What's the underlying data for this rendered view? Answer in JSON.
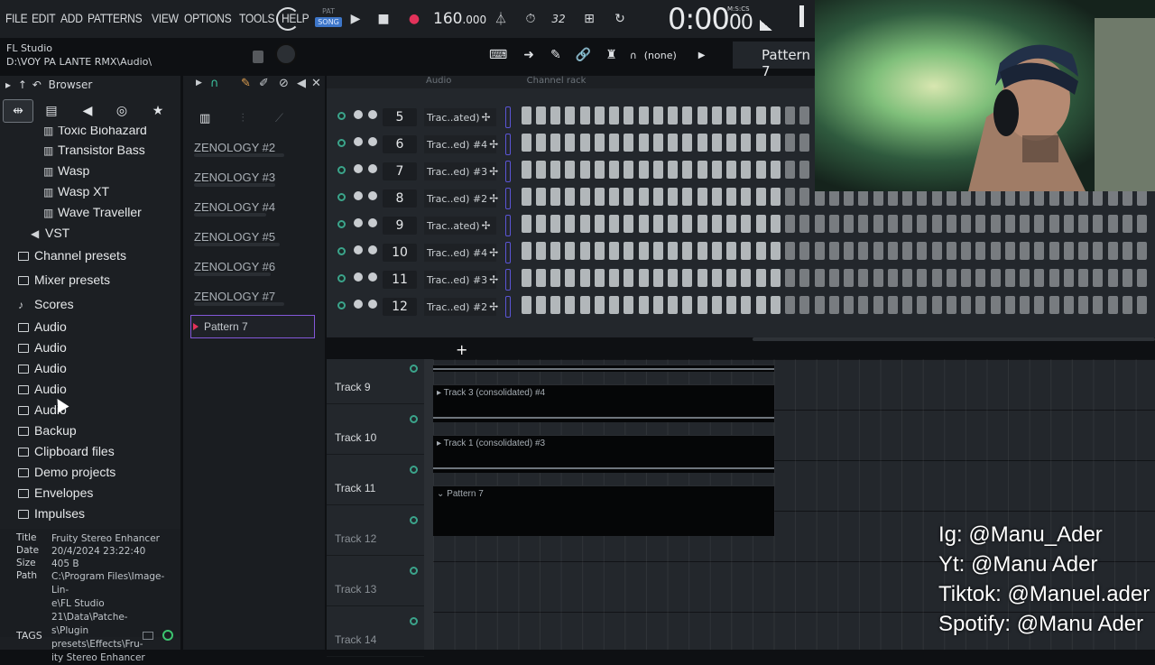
{
  "menu": [
    "FILE",
    "EDIT",
    "ADD",
    "PATTERNS",
    "VIEW",
    "OPTIONS",
    "TOOLS",
    "HELP"
  ],
  "app": {
    "name": "FL Studio",
    "project_path": "D:\\VOY PA LANTE RMX\\Audio\\"
  },
  "transport": {
    "pat_label": "PAT",
    "song_label": "SONG",
    "tempo": "160",
    "tempo_frac": ".000",
    "time_main": "0:00",
    "time_small": "00",
    "time_unit": "M:S:CS",
    "cpu_label": "32"
  },
  "toolbar2": {
    "midi_none": "(none)",
    "pattern": "Pattern 7"
  },
  "browser": {
    "title": "Browser",
    "items": [
      {
        "label": "Toxic Biohazard",
        "icon": "piano-icon"
      },
      {
        "label": "Transistor Bass",
        "icon": "piano-icon"
      },
      {
        "label": "Wasp",
        "icon": "piano-icon"
      },
      {
        "label": "Wasp XT",
        "icon": "piano-icon"
      },
      {
        "label": "Wave Traveller",
        "icon": "piano-icon"
      },
      {
        "label": "VST",
        "icon": "speaker-icon"
      },
      {
        "label": "Channel presets",
        "icon": "folder-icon"
      },
      {
        "label": "Mixer presets",
        "icon": "folder-icon"
      },
      {
        "label": "Scores",
        "icon": "note-icon"
      },
      {
        "label": "Audio",
        "icon": "folder-icon"
      },
      {
        "label": "Audio",
        "icon": "folder-icon"
      },
      {
        "label": "Audio",
        "icon": "folder-icon"
      },
      {
        "label": "Audio",
        "icon": "folder-icon"
      },
      {
        "label": "Audio",
        "icon": "folder-icon"
      },
      {
        "label": "Backup",
        "icon": "folder-icon"
      },
      {
        "label": "Clipboard files",
        "icon": "folder-icon"
      },
      {
        "label": "Demo projects",
        "icon": "folder-icon"
      },
      {
        "label": "Envelopes",
        "icon": "folder-icon"
      },
      {
        "label": "Impulses",
        "icon": "folder-icon"
      }
    ],
    "file_info": {
      "title_label": "Title",
      "title": "Fruity Stereo Enhancer",
      "date_label": "Date",
      "date": "20/4/2024 23:22:40",
      "size_label": "Size",
      "size": "405 B",
      "path_label": "Path",
      "path_lines": [
        "C:\\Program Files\\Image-Lin-",
        "e\\FL Studio 21\\Data\\Patche-",
        "s\\Plugin presets\\Effects\\Fru-",
        "ity Stereo Enhancer"
      ]
    },
    "tags_label": "TAGS"
  },
  "patterns": [
    "ZENOLOGY #2",
    "ZENOLOGY #3",
    "ZENOLOGY #4",
    "ZENOLOGY #5",
    "ZENOLOGY #6",
    "ZENOLOGY #7",
    "Pattern 7"
  ],
  "channel_rack": {
    "header_left": "Audio",
    "header_right": "Channel rack",
    "channels": [
      {
        "num": "5",
        "name": "Trac..ated)"
      },
      {
        "num": "6",
        "name": "Trac..ed) #4"
      },
      {
        "num": "7",
        "name": "Trac..ed) #3"
      },
      {
        "num": "8",
        "name": "Trac..ed) #2"
      },
      {
        "num": "9",
        "name": "Trac..ated)"
      },
      {
        "num": "10",
        "name": "Trac..ed) #4"
      },
      {
        "num": "11",
        "name": "Trac..ed) #3"
      },
      {
        "num": "12",
        "name": "Trac..ed) #2"
      }
    ],
    "add_label": "+"
  },
  "playlist": {
    "tracks": [
      "Track 9",
      "Track 10",
      "Track 11",
      "Track 12",
      "Track 13",
      "Track 14"
    ],
    "clips": [
      "Track 3 (consolidated) #4",
      "Track 1 (consolidated) #3",
      "Pattern 7"
    ]
  },
  "social": [
    "Ig: @Manu_Ader",
    "Yt: @Manu Ader",
    "Tiktok: @Manuel.ader",
    "Spotify: @Manu Ader"
  ],
  "colors": {
    "accent_purple": "#8357d8",
    "led_green": "#3ba48b",
    "song_blue": "#3d76c9",
    "record_red": "#e2325a"
  }
}
